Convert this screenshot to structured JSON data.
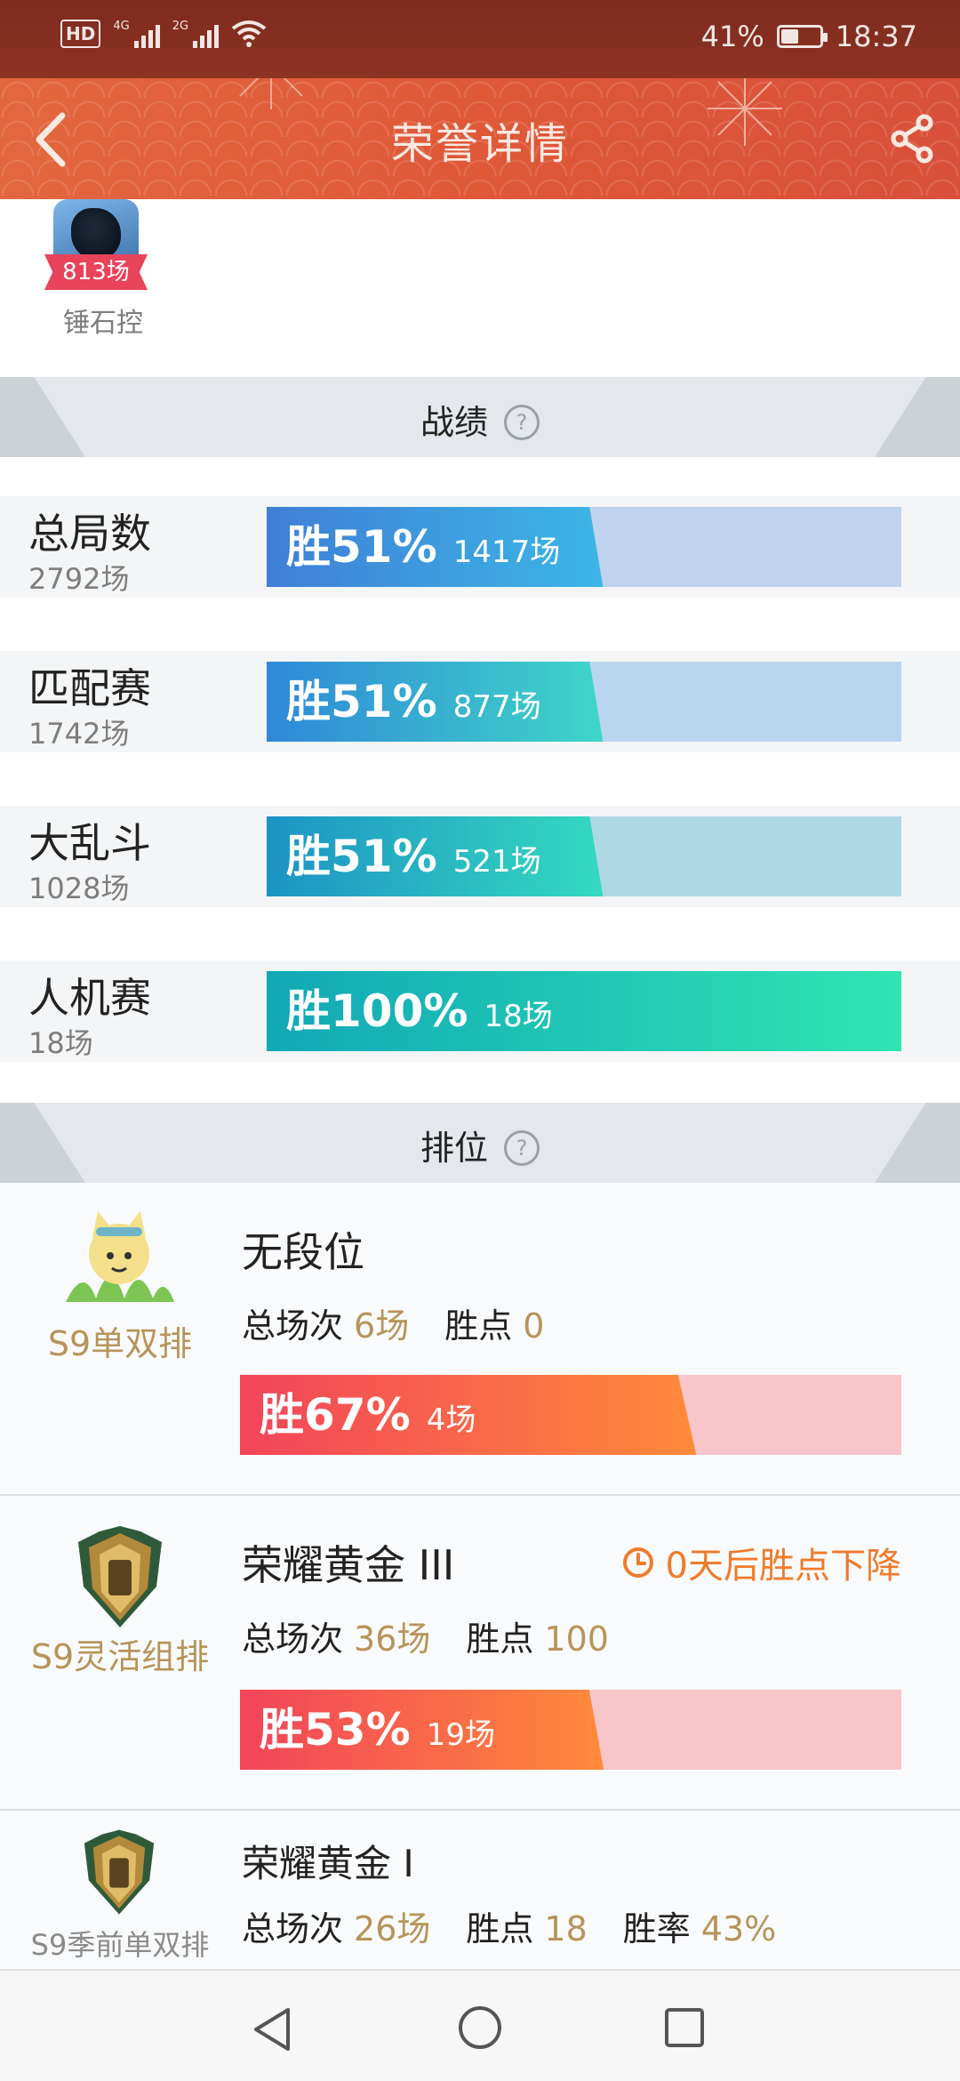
{
  "status_bar": {
    "hd_label": "HD",
    "net1": "4G",
    "net2": "2G",
    "battery_percent": "41%",
    "battery_level": 0.41,
    "time": "18:37"
  },
  "header": {
    "title": "荣誉详情"
  },
  "hero": {
    "games": "813场",
    "name": "锤石控"
  },
  "record_section": {
    "title": "战绩",
    "help": "?"
  },
  "stats": [
    {
      "name": "总局数",
      "count": "2792场",
      "win": "胜51%",
      "games": "1417场",
      "win_fraction": 0.51
    },
    {
      "name": "匹配赛",
      "count": "1742场",
      "win": "胜51%",
      "games": "877场",
      "win_fraction": 0.51
    },
    {
      "name": "大乱斗",
      "count": "1028场",
      "win": "胜51%",
      "games": "521场",
      "win_fraction": 0.51
    },
    {
      "name": "人机赛",
      "count": "18场",
      "win": "胜100%",
      "games": "18场",
      "win_fraction": 1.0
    }
  ],
  "rank_section": {
    "title": "排位",
    "help": "?"
  },
  "ranks": [
    {
      "queue": "S9单双排",
      "tier": "无段位",
      "total_label": "总场次",
      "total": "6场",
      "lp_label": "胜点",
      "lp": "0",
      "win": "胜67%",
      "games": "4场",
      "win_fraction": 0.67
    },
    {
      "queue": "S9灵活组排",
      "tier": "荣耀黄金 III",
      "decay": "0天后胜点下降",
      "total_label": "总场次",
      "total": "36场",
      "lp_label": "胜点",
      "lp": "100",
      "win": "胜53%",
      "games": "19场",
      "win_fraction": 0.53
    },
    {
      "queue": "S9季前单双排",
      "tier": "荣耀黄金 I",
      "total_label": "总场次",
      "total": "26场",
      "lp_label": "胜点",
      "lp": "18",
      "rate_label": "胜率",
      "rate": "43%"
    }
  ],
  "colors": {
    "header": "#df5838",
    "gold_text": "#b6945a",
    "decay": "#ef7b2c",
    "rank_bar_fill_start": "#f2445a",
    "rank_bar_fill_end": "#ff8a3a",
    "rank_bar_track": "#f8c5ca"
  },
  "icons": {
    "back": "chevron-left-icon",
    "share": "share-icon",
    "clock": "clock-icon",
    "nav_back": "triangle-back-icon",
    "nav_home": "circle-home-icon",
    "nav_recent": "square-recent-icon"
  }
}
